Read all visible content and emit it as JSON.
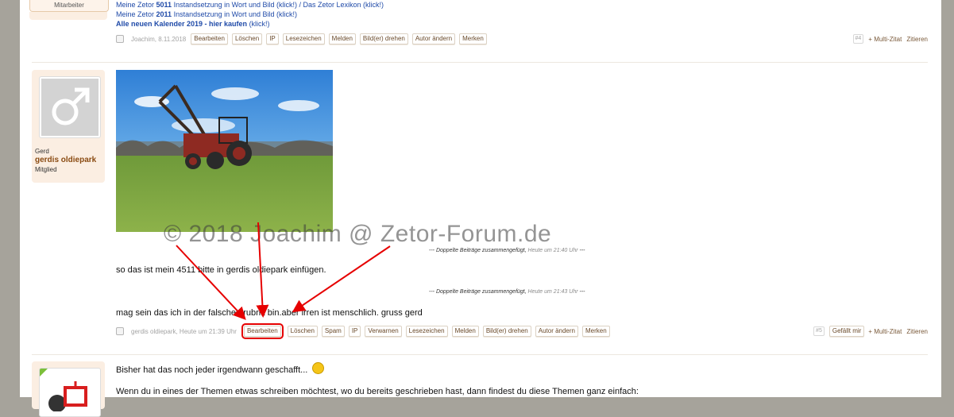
{
  "post_top": {
    "user_role_tab": "Mitarbeiter",
    "signature": [
      {
        "a": "Meine Zetor ",
        "b": "5011",
        "c": " Instandsetzung in Wort und Bild (klick!)",
        "d": " / Das Zetor Lexikon (klick!)"
      },
      {
        "a": "Meine Zetor ",
        "b": "2011",
        "c": " Instandsetzung in Wort und Bild (klick!)",
        "d": ""
      },
      {
        "a": "",
        "b": "Alle neuen Kalender 2019 - hier kaufen",
        "c": " (klick!)",
        "d": ""
      }
    ],
    "meta": "Joachim, 8.11.2018",
    "actions": [
      "Bearbeiten",
      "Löschen",
      "IP",
      "Lesezeichen",
      "Melden",
      "Bild(er) drehen",
      "Autor ändern",
      "Merken"
    ],
    "post_number": "#4",
    "multi_quote": "+ Multi-Zitat",
    "quote": "Zitieren"
  },
  "post_main": {
    "user_first_name": "Gerd",
    "user_name": "gerdis oldiepark",
    "user_title": "Mitglied",
    "avatar_icon": "male-symbol-icon",
    "watermark": "© 2018 Joachim @ Zetor-Forum.de",
    "merged_label": "--- Doppelte Beiträge zusammengefügt,",
    "merged_time_1": "Heute um 21:40 Uhr",
    "merged_time_2": "Heute um 21:43 Uhr",
    "merged_end": "---",
    "message_1": "so das ist mein 4511 bitte in gerdis oldiepark einfügen.",
    "message_2": "mag sein das ich in der falschen rubrik bin.aber irren ist menschlich. gruss gerd",
    "meta": "gerdis oldiepark, Heute um 21:39 Uhr",
    "actions": [
      "Bearbeiten",
      "Löschen",
      "Spam",
      "IP",
      "Verwarnen",
      "Lesezeichen",
      "Melden",
      "Bild(er) drehen",
      "Autor ändern",
      "Merken"
    ],
    "post_number": "#5",
    "like": "Gefällt mir",
    "multi_quote": "+ Multi-Zitat",
    "quote": "Zitieren"
  },
  "post_next": {
    "line_1": "Bisher hat das noch jeder irgendwann geschafft...",
    "line_2": "Wenn du in eines der Themen etwas schreiben möchtest, wo du bereits geschrieben hast, dann findest du diese Themen ganz einfach:"
  },
  "colors": {
    "highlight": "#e60000",
    "link": "#1f4aa8",
    "user": "#8a4b12",
    "sidebar": "#a6a39b"
  }
}
